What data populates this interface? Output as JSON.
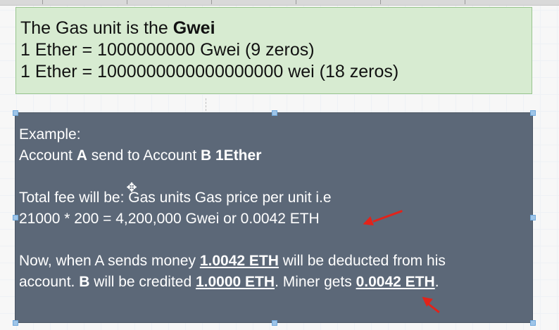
{
  "top_box": {
    "line1_prefix": "The Gas unit is the ",
    "line1_bold": "Gwei",
    "line2": "1 Ether = 1000000000 Gwei (9 zeros)",
    "line3": "1 Ether = 1000000000000000000 wei (18 zeros)"
  },
  "bottom_box": {
    "example_label": "Example:",
    "tx_prefix": "Account ",
    "tx_a": "A",
    "tx_mid": " send to Account ",
    "tx_b": "B",
    "tx_amount": " 1Ether",
    "fee_line": "Total fee will be: Gas units Gas price per unit i.e",
    "calc_line": "21000 * 200 = 4,200,000 Gwei or 0.0042 ETH",
    "now_prefix": "Now, when A sends money ",
    "now_amount": "1.0042 ETH",
    "now_suffix": " will be deducted from his",
    "acct_prefix": "account. ",
    "acct_b": "B",
    "acct_mid": " will be credited ",
    "acct_credit": "1.0000 ETH",
    "acct_miner": ". Miner gets ",
    "acct_miner_amount": "0.0042 ETH",
    "acct_end": "."
  },
  "colors": {
    "top_box_bg": "#d7ebd1",
    "bottom_box_bg": "#5c6878",
    "arrow": "#e2231a"
  }
}
